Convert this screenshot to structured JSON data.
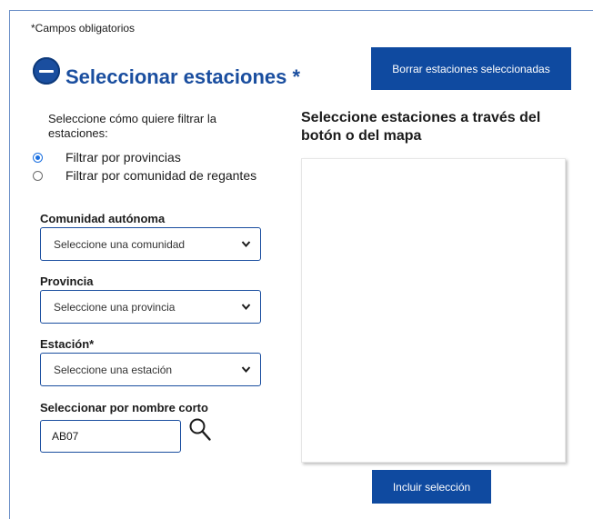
{
  "form": {
    "required_note": "*Campos obligatorios",
    "section_title": "Seleccionar estaciones *",
    "clear_button": "Borrar estaciones seleccionadas",
    "filter_prompt": "Seleccione cómo quiere filtrar la estaciones:",
    "filter_options": [
      {
        "label": "Filtrar por provincias",
        "selected": true
      },
      {
        "label": "Filtrar por comunidad de regantes",
        "selected": false
      }
    ],
    "comunidad": {
      "label": "Comunidad autónoma",
      "value": "Seleccione una comunidad"
    },
    "provincia": {
      "label": "Provincia",
      "value": "Seleccione una provincia"
    },
    "estacion": {
      "label": "Estación*",
      "value": "Seleccione una estación"
    },
    "nombre_corto": {
      "label": "Seleccionar por nombre corto",
      "value": "AB07"
    }
  },
  "map": {
    "heading": "Seleccione estaciones a través del botón o del mapa",
    "include_button": "Incluir selección"
  },
  "colors": {
    "primary": "#0f4aa0",
    "title": "#1a4e9f",
    "radio_accent": "#1a6fe0"
  },
  "icons": [
    "collapse-minus-icon",
    "chevron-down-icon",
    "search-icon"
  ]
}
